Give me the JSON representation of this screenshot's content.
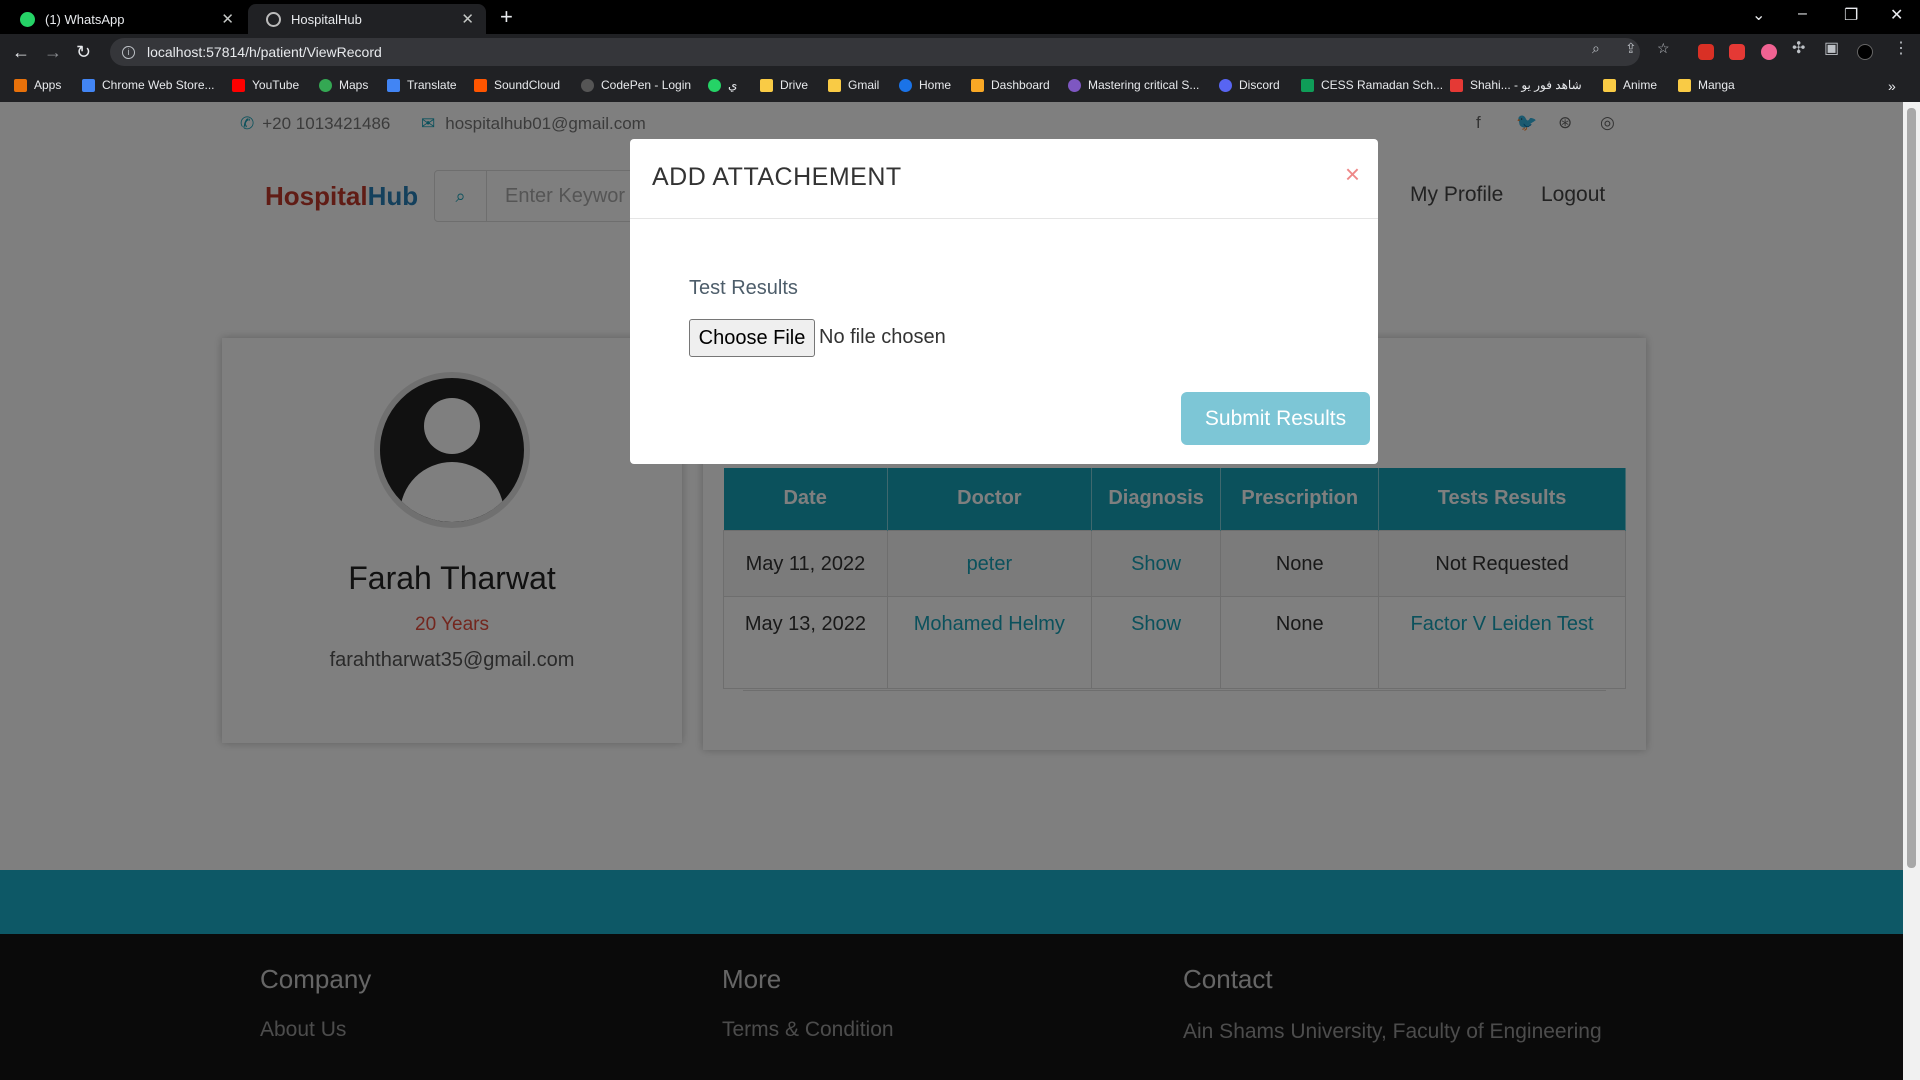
{
  "browser": {
    "tabs": [
      {
        "title": "(1) WhatsApp",
        "icon": "whatsapp-icon"
      },
      {
        "title": "HospitalHub",
        "icon": "globe-icon"
      }
    ],
    "url": "localhost:57814/h/patient/ViewRecord",
    "bookmarks": [
      "Apps",
      "Chrome Web Store...",
      "YouTube",
      "Maps",
      "Translate",
      "SoundCloud",
      "CodePen - Login",
      "ي",
      "Drive",
      "Gmail",
      "Home",
      "Dashboard",
      "Mastering critical S...",
      "Discord",
      "CESS Ramadan Sch...",
      "Shahi... - شاهد فور يو",
      "Anime",
      "Manga"
    ]
  },
  "topbar": {
    "phone": "+20 1013421486",
    "email": "hospitalhub01@gmail.com"
  },
  "nav": {
    "logo_part1": "Hospital",
    "logo_part2": "Hub",
    "search_placeholder": "Enter Keywor",
    "profile": "My Profile",
    "logout": "Logout"
  },
  "patient": {
    "name": "Farah Tharwat",
    "age": "20 Years",
    "email": "farahtharwat35@gmail.com"
  },
  "records": {
    "headers": [
      "Date",
      "Doctor",
      "Diagnosis",
      "Prescription",
      "Tests Results"
    ],
    "rows": [
      {
        "date": "May 11, 2022",
        "doctor": "peter",
        "diagnosis": "Show",
        "prescription": "None",
        "tests": "Not Requested"
      },
      {
        "date": "May 13, 2022",
        "doctor": "Mohamed Helmy",
        "diagnosis": "Show",
        "prescription": "None",
        "tests": "Factor V Leiden Test"
      }
    ]
  },
  "footer": {
    "company": "Company",
    "more": "More",
    "contact": "Contact",
    "about": "About Us",
    "terms": "Terms & Condition",
    "address": "Ain Shams University, Faculty of Engineering"
  },
  "modal": {
    "title": "ADD ATTACHEMENT",
    "close": "×",
    "field_label": "Test Results",
    "file_button": "Choose File",
    "file_status": "No file chosen",
    "submit": "Submit Results"
  },
  "colors": {
    "accent": "#17a2b8",
    "logo_red": "#c0392b",
    "logo_blue": "#2980b9",
    "submit": "#7dc6d6"
  }
}
